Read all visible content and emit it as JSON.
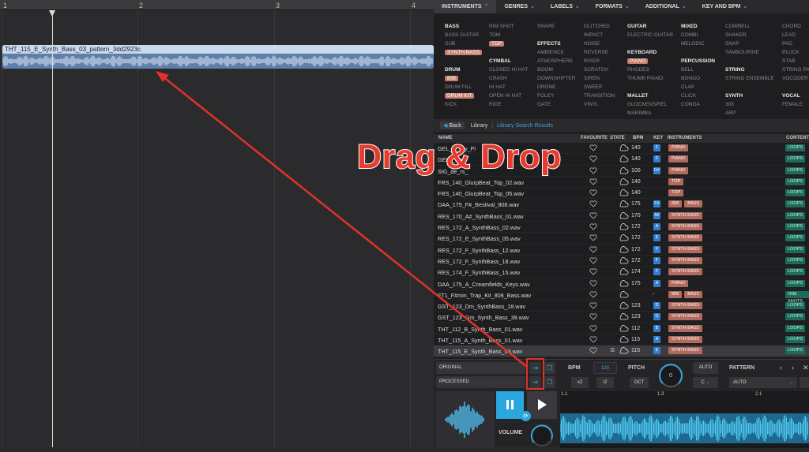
{
  "daw": {
    "ruler_numbers": [
      "1",
      "2",
      "3",
      "4"
    ],
    "region_title": "THT_115_E_Synth_Bass_03_pattern_3dd2923c"
  },
  "plugin": {
    "tabs": [
      {
        "label": "INSTRUMENTS"
      },
      {
        "label": "GENRES"
      },
      {
        "label": "LABELS"
      },
      {
        "label": "FORMATS"
      },
      {
        "label": "ADDITIONAL"
      },
      {
        "label": "KEY AND BPM"
      }
    ],
    "categories": {
      "col1": [
        {
          "t": "BASS",
          "h": true
        },
        {
          "t": "BASS GUITAR"
        },
        {
          "t": "SUB"
        },
        {
          "t": "SYNTH BASS",
          "sel": true
        },
        {
          "t": ""
        },
        {
          "t": "DRUM",
          "h": true
        },
        {
          "t": "808",
          "sel": true
        },
        {
          "t": "DRUM FILL"
        },
        {
          "t": "DRUM KIT",
          "sel": true
        },
        {
          "t": "KICK"
        }
      ],
      "col2": [
        {
          "t": "RIM SHOT"
        },
        {
          "t": "TOM"
        },
        {
          "t": "TOP",
          "sel": true
        },
        {
          "t": ""
        },
        {
          "t": "CYMBAL",
          "h": true
        },
        {
          "t": "CLOSED HI HAT"
        },
        {
          "t": "CRASH"
        },
        {
          "t": "HI HAT"
        },
        {
          "t": "OPEN HI HAT"
        },
        {
          "t": "RIDE"
        }
      ],
      "col3": [
        {
          "t": "SNARE"
        },
        {
          "t": ""
        },
        {
          "t": "EFFECTS",
          "h": true
        },
        {
          "t": "AMBIENCE"
        },
        {
          "t": "ATMOSPHERE"
        },
        {
          "t": "BOOM"
        },
        {
          "t": "DOWNSHIFTER"
        },
        {
          "t": "DRONE"
        },
        {
          "t": "FOLEY"
        },
        {
          "t": "GATE"
        }
      ],
      "col4": [
        {
          "t": "GLITCHED"
        },
        {
          "t": "IMPACT"
        },
        {
          "t": "NOISE"
        },
        {
          "t": "REVERSE"
        },
        {
          "t": "RISER"
        },
        {
          "t": "SCRATCH"
        },
        {
          "t": "SIREN"
        },
        {
          "t": "SWEEP"
        },
        {
          "t": "TRANSITION"
        },
        {
          "t": "VINYL"
        }
      ],
      "col5": [
        {
          "t": "GUITAR",
          "h": true
        },
        {
          "t": "ELECTRIC GUITAR"
        },
        {
          "t": ""
        },
        {
          "t": "KEYBOARD",
          "h": true
        },
        {
          "t": "PIANO",
          "sel": true
        },
        {
          "t": "RHODES"
        },
        {
          "t": "THUMB PIANO"
        },
        {
          "t": ""
        },
        {
          "t": "MALLET",
          "h": true
        },
        {
          "t": "GLOCKENSPIEL"
        },
        {
          "t": "MARIMBA"
        }
      ],
      "col6": [
        {
          "t": "MIXED",
          "h": true
        },
        {
          "t": "COMBI"
        },
        {
          "t": "MELODIC"
        },
        {
          "t": ""
        },
        {
          "t": "PERCUSSION",
          "h": true
        },
        {
          "t": "BELL"
        },
        {
          "t": "BONGO"
        },
        {
          "t": "CLAP"
        },
        {
          "t": "CLICK"
        },
        {
          "t": "CONGA"
        }
      ],
      "col7": [
        {
          "t": "COWBELL"
        },
        {
          "t": "SHAKER"
        },
        {
          "t": "SNAP"
        },
        {
          "t": "TAMBOURINE"
        },
        {
          "t": ""
        },
        {
          "t": "STRING",
          "h": true
        },
        {
          "t": "STRING ENSEMBLE"
        },
        {
          "t": ""
        },
        {
          "t": "SYNTH",
          "h": true
        },
        {
          "t": "303"
        },
        {
          "t": "ARP"
        }
      ],
      "col8": [
        {
          "t": "CHORD"
        },
        {
          "t": "LEAD"
        },
        {
          "t": "PAD"
        },
        {
          "t": "PLUCK"
        },
        {
          "t": "STAB"
        },
        {
          "t": "STRING PAD"
        },
        {
          "t": "VOCODER"
        },
        {
          "t": ""
        },
        {
          "t": "VOCAL",
          "h": true
        },
        {
          "t": "FEMALE"
        }
      ]
    },
    "breadcrumb": {
      "back": "Back",
      "library": "Library",
      "results": "Library Search Results"
    },
    "table_headers": {
      "name": "NAME",
      "favourite": "FAVOURITE",
      "state": "STATE",
      "bpm": "BPM",
      "key": "KEY",
      "instruments": "INSTRUMENTS",
      "content": "CONTENT"
    },
    "rows": [
      {
        "name": "GEL_1__zy_Pi",
        "bpm": "140",
        "key": "F",
        "inst": [
          "PIANO"
        ],
        "ct": "LOOPS"
      },
      {
        "name": "GEL__Lo",
        "bpm": "140",
        "key": "F",
        "inst": [
          "PIANO"
        ],
        "ct": "LOOPS"
      },
      {
        "name": "SIG_de_rs_",
        "bpm": "100",
        "key": "D#",
        "inst": [
          "PIANO"
        ],
        "ct": "LOOPS"
      },
      {
        "name": "FRS_140_GlurpBeat_Top_02.wav",
        "bpm": "140",
        "key": "",
        "inst": [
          "TOP"
        ],
        "ct": "LOOPS"
      },
      {
        "name": "FRS_140_GlurpBeat_Top_05.wav",
        "bpm": "140",
        "key": "",
        "inst": [
          "TOP"
        ],
        "ct": "LOOPS"
      },
      {
        "name": "DAA_175_F#_Bestival_808.wav",
        "bpm": "175",
        "key": "F#",
        "inst": [
          "808",
          "BASS"
        ],
        "ct": "LOOPS"
      },
      {
        "name": "RES_170_A#_SynthBass_01.wav",
        "bpm": "170",
        "key": "A#",
        "inst": [
          "SYNTH BASS"
        ],
        "ct": "LOOPS"
      },
      {
        "name": "RES_172_A_SynthBass_02.wav",
        "bpm": "172",
        "key": "A",
        "inst": [
          "SYNTH BASS"
        ],
        "ct": "LOOPS"
      },
      {
        "name": "RES_172_E_SynthBass_05.wav",
        "bpm": "172",
        "key": "E",
        "inst": [
          "SYNTH BASS"
        ],
        "ct": "LOOPS"
      },
      {
        "name": "RES_172_F_SynthBass_12.wav",
        "bpm": "172",
        "key": "F",
        "inst": [
          "SYNTH BASS"
        ],
        "ct": "LOOPS"
      },
      {
        "name": "RES_172_F_SynthBass_18.wav",
        "bpm": "172",
        "key": "F",
        "inst": [
          "SYNTH BASS"
        ],
        "ct": "LOOPS"
      },
      {
        "name": "RES_174_F_SynthBass_15.wav",
        "bpm": "174",
        "key": "F",
        "inst": [
          "SYNTH BASS"
        ],
        "ct": "LOOPS"
      },
      {
        "name": "DAA_175_A_Creamfields_Keys.wav",
        "bpm": "175",
        "key": "A",
        "inst": [
          "PIANO"
        ],
        "ct": "LOOPS"
      },
      {
        "name": "FT1_F#min_Trap_Kit_808_Bass.wav",
        "bpm": "",
        "key": "",
        "inst": [
          "808",
          "BASS"
        ],
        "ct": "ONE SHOTS"
      },
      {
        "name": "GST_123_Dm_SynthBass_18.wav",
        "bpm": "123",
        "key": "D",
        "inst": [
          "SYNTH BASS"
        ],
        "ct": "LOOPS"
      },
      {
        "name": "GST_123_Gm_Synth_Bass_39.wav",
        "bpm": "123",
        "key": "G",
        "inst": [
          "SYNTH BASS"
        ],
        "ct": "LOOPS"
      },
      {
        "name": "THT_112_B_Synth_Bass_01.wav",
        "bpm": "112",
        "key": "B",
        "inst": [
          "SYNTH BASS"
        ],
        "ct": "LOOPS"
      },
      {
        "name": "THT_115_A_Synth_Bass_01.wav",
        "bpm": "115",
        "key": "A",
        "inst": [
          "SYNTH BASS"
        ],
        "ct": "LOOPS"
      },
      {
        "name": "THT_115_E_Synth_Bass_03.wav",
        "bpm": "115",
        "key": "E",
        "inst": [
          "SYNTH BASS"
        ],
        "ct": "LOOPS",
        "hl": true
      }
    ],
    "player": {
      "original": "ORIGINAL",
      "processed": "PROCESSED",
      "bpm_label": "BPM",
      "bpm_value": "120",
      "x2": "x2",
      "half": "/2",
      "pitch_label": "PITCH",
      "pitch_value": "0",
      "auto": "AUTO",
      "oct": "OCT",
      "key_sel": "C",
      "pattern_label": "PATTERN",
      "pattern_sel": "AUTO",
      "volume_label": "VOLUME",
      "markers": [
        "1.1",
        "1.3",
        "2.1"
      ]
    }
  },
  "overlay": {
    "text": "Drag & Drop",
    "color": "#e83a2e"
  }
}
